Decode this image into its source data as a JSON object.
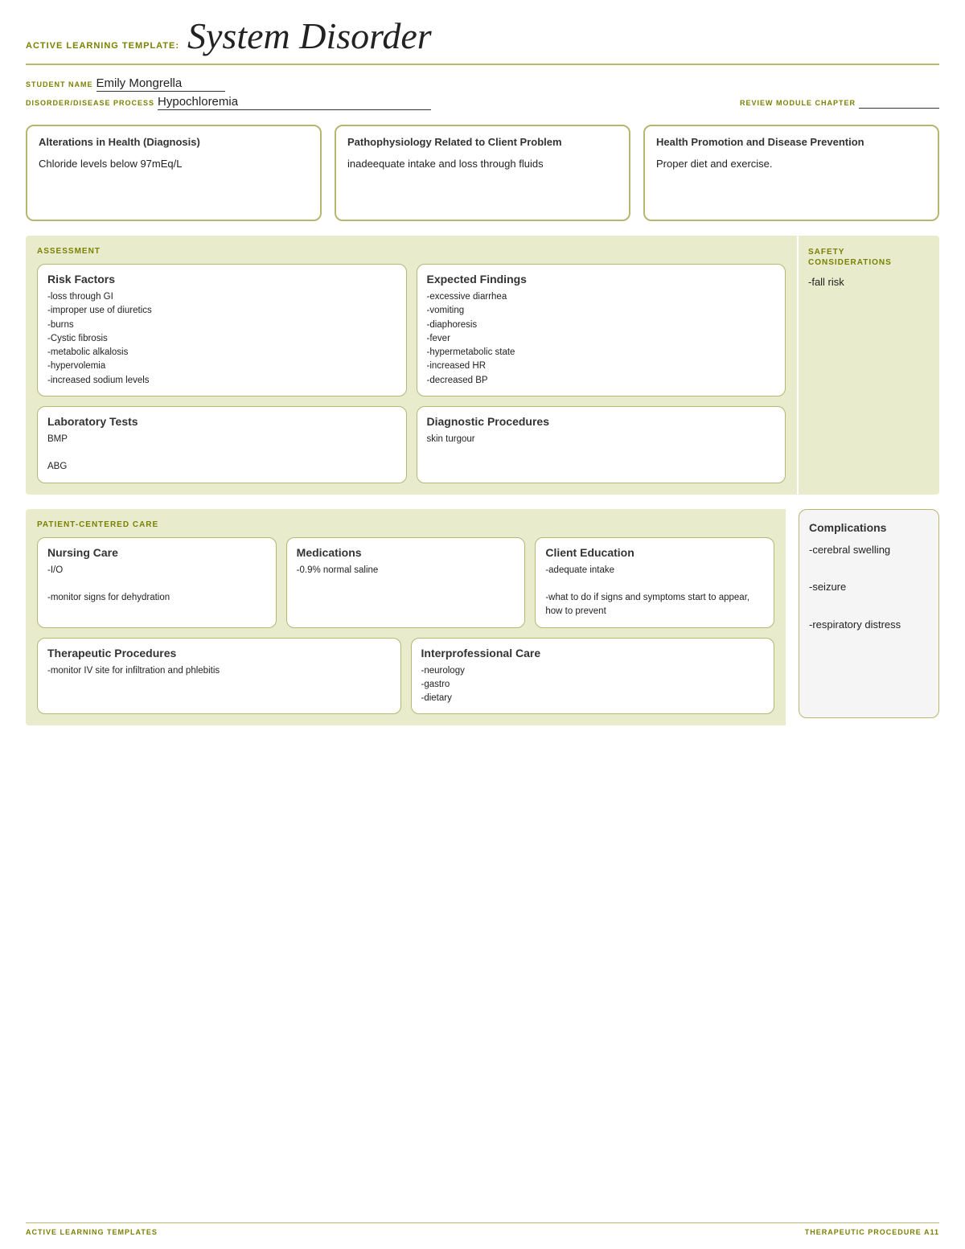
{
  "header": {
    "label": "ACTIVE LEARNING TEMPLATE:",
    "title": "System Disorder"
  },
  "student": {
    "name_label": "STUDENT NAME",
    "name_value": "Emily Mongrella",
    "disorder_label": "DISORDER/DISEASE PROCESS",
    "disorder_value": "Hypochloremia",
    "review_label": "REVIEW MODULE CHAPTER"
  },
  "top_boxes": [
    {
      "title": "Alterations in Health (Diagnosis)",
      "content": "Chloride levels below 97mEq/L"
    },
    {
      "title": "Pathophysiology Related to Client Problem",
      "content": "inadeequate intake and loss through fluids"
    },
    {
      "title": "Health Promotion and Disease Prevention",
      "content": "Proper diet and exercise."
    }
  ],
  "assessment": {
    "label": "ASSESSMENT",
    "risk_factors": {
      "title": "Risk Factors",
      "content": "-loss through GI\n-improper use of diuretics\n-burns\n-Cystic fibrosis\n-metabolic alkalosis\n-hypervolemia\n-increased sodium levels"
    },
    "expected_findings": {
      "title": "Expected Findings",
      "content": "-excessive diarrhea\n-vomiting\n-diaphoresis\n-fever\n-hypermetabolic state\n-increased HR\n-decreased BP"
    },
    "lab_tests": {
      "title": "Laboratory Tests",
      "content": "BMP\n\nABG"
    },
    "diagnostic_procedures": {
      "title": "Diagnostic Procedures",
      "content": "skin turgour"
    }
  },
  "safety": {
    "title": "SAFETY\nCONSIDERATIONS",
    "content": "-fall risk"
  },
  "patient_care": {
    "label": "PATIENT-CENTERED CARE",
    "nursing_care": {
      "title": "Nursing Care",
      "content": "-I/O\n\n-monitor signs for dehydration"
    },
    "medications": {
      "title": "Medications",
      "content": "-0.9% normal saline"
    },
    "client_education": {
      "title": "Client Education",
      "content": "-adequate intake\n\n-what to do if signs and symptoms start to appear, how to prevent"
    },
    "therapeutic_procedures": {
      "title": "Therapeutic Procedures",
      "content": "-monitor IV site for infiltration and phlebitis"
    },
    "interprofessional_care": {
      "title": "Interprofessional Care",
      "content": "-neurology\n-gastro\n-dietary"
    }
  },
  "complications": {
    "title": "Complications",
    "content": "-cerebral swelling\n\n-seizure\n\n-respiratory distress"
  },
  "footer": {
    "left": "ACTIVE LEARNING TEMPLATES",
    "right": "THERAPEUTIC PROCEDURE  A11"
  }
}
